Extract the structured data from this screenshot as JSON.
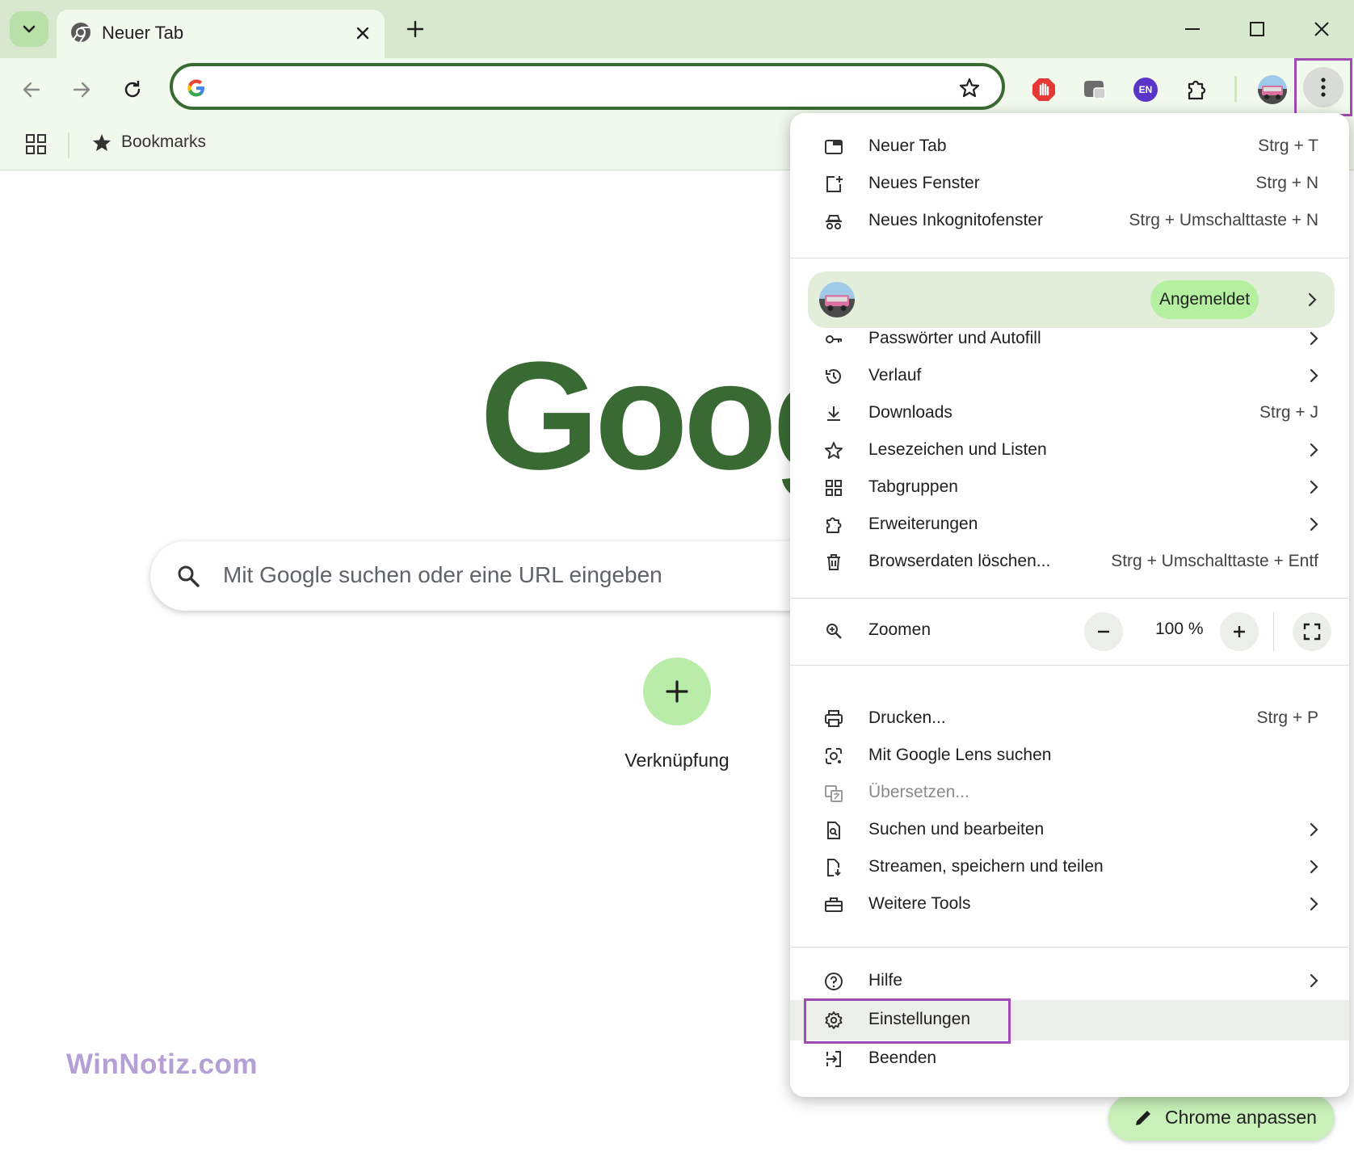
{
  "tab": {
    "title": "Neuer Tab"
  },
  "bookmarks_bar": {
    "label": "Bookmarks"
  },
  "extensions": {
    "lang_badge": "EN"
  },
  "main": {
    "logo_text": "Goog",
    "search_placeholder": "Mit Google suchen oder eine URL eingeben",
    "shortcut_label": "Verknüpfung",
    "customize_label": "Chrome anpassen"
  },
  "watermark": "WinNotiz.com",
  "menu": {
    "group1": [
      {
        "label": "Neuer Tab",
        "shortcut": "Strg + T",
        "icon": "new-tab-icon"
      },
      {
        "label": "Neues Fenster",
        "shortcut": "Strg + N",
        "icon": "new-window-icon"
      },
      {
        "label": "Neues Inkognitofenster",
        "shortcut": "Strg + Umschalttaste + N",
        "icon": "incognito-icon"
      }
    ],
    "profile": {
      "status": "Angemeldet"
    },
    "group2": [
      {
        "label": "Passwörter und Autofill",
        "icon": "key-icon"
      },
      {
        "label": "Verlauf",
        "icon": "history-icon"
      },
      {
        "label": "Downloads",
        "shortcut": "Strg + J",
        "icon": "download-icon"
      },
      {
        "label": "Lesezeichen und Listen",
        "icon": "star-icon"
      },
      {
        "label": "Tabgruppen",
        "icon": "tab-groups-icon"
      },
      {
        "label": "Erweiterungen",
        "icon": "puzzle-icon"
      },
      {
        "label": "Browserdaten löschen...",
        "shortcut": "Strg + Umschalttaste + Entf",
        "icon": "trash-icon"
      }
    ],
    "zoom": {
      "label": "Zoomen",
      "value": "100 %"
    },
    "group3": [
      {
        "label": "Drucken...",
        "shortcut": "Strg + P",
        "icon": "print-icon"
      },
      {
        "label": "Mit Google Lens suchen",
        "icon": "lens-icon"
      },
      {
        "label": "Übersetzen...",
        "icon": "translate-icon"
      },
      {
        "label": "Suchen und bearbeiten",
        "icon": "find-icon"
      },
      {
        "label": "Streamen, speichern und teilen",
        "icon": "cast-save-icon"
      },
      {
        "label": "Weitere Tools",
        "icon": "toolbox-icon"
      }
    ],
    "group4": [
      {
        "label": "Hilfe",
        "icon": "help-icon"
      },
      {
        "label": "Einstellungen",
        "icon": "gear-icon"
      },
      {
        "label": "Beenden",
        "icon": "exit-icon"
      }
    ]
  },
  "colors": {
    "accent": "#3a6a33",
    "highlight": "#a04ab3",
    "frame": "#d7e8ce",
    "toolbar": "#f1f8ec"
  }
}
